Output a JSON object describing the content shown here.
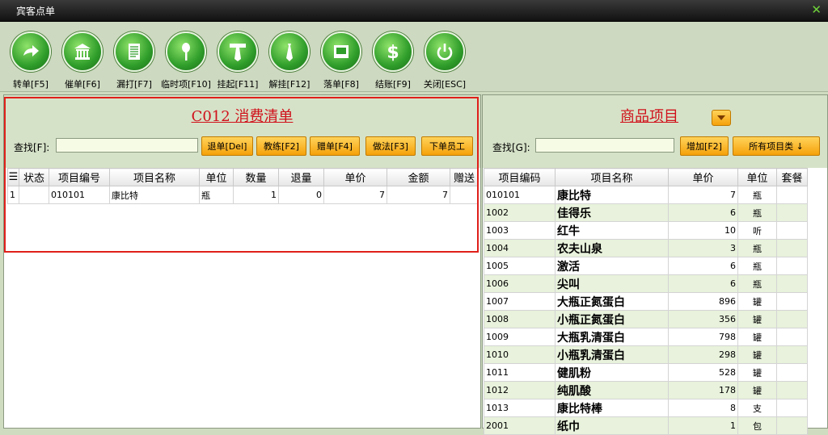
{
  "window": {
    "title": "宾客点单"
  },
  "toolbar": {
    "buttons": [
      {
        "label": "转单[F5]",
        "icon": "arrow-forward-icon"
      },
      {
        "label": "催单[F6]",
        "icon": "bank-icon"
      },
      {
        "label": "漏打[F7]",
        "icon": "document-icon"
      },
      {
        "label": "临时项[F10]",
        "icon": "utensils-icon"
      },
      {
        "label": "挂起[F11]",
        "icon": "tie-icon"
      },
      {
        "label": "解挂[F12]",
        "icon": "necktie-icon"
      },
      {
        "label": "落单[F8]",
        "icon": "receipt-icon"
      },
      {
        "label": "结账[F9]",
        "icon": "dollar-icon"
      },
      {
        "label": "关闭[ESC]",
        "icon": "power-icon"
      }
    ]
  },
  "left": {
    "title": "C012 消费清单",
    "search_label": "查找[F]:",
    "search_value": "",
    "buttons": [
      "退单[Del]",
      "教练[F2]",
      "赠单[F4]",
      "做法[F3]",
      "下单员工"
    ],
    "columns": [
      "状态",
      "项目编号",
      "项目名称",
      "单位",
      "数量",
      "退量",
      "单价",
      "金额",
      "赠送"
    ],
    "rows": [
      {
        "idx": "1",
        "status": "",
        "code": "010101",
        "name": "康比特",
        "unit": "瓶",
        "qty": "1",
        "ret": "0",
        "price": "7",
        "amount": "7",
        "gift": ""
      }
    ]
  },
  "right": {
    "title": "商品项目",
    "search_label": "查找[G]:",
    "search_value": "",
    "add_button": "增加[F2]",
    "category_button": "所有项目类 ↓",
    "columns": [
      "项目编码",
      "项目名称",
      "单价",
      "单位",
      "套餐"
    ],
    "rows": [
      {
        "code": "010101",
        "name": "康比特",
        "price": "7",
        "unit": "瓶",
        "set": ""
      },
      {
        "code": "1002",
        "name": "佳得乐",
        "price": "6",
        "unit": "瓶",
        "set": ""
      },
      {
        "code": "1003",
        "name": "红牛",
        "price": "10",
        "unit": "听",
        "set": ""
      },
      {
        "code": "1004",
        "name": "农夫山泉",
        "price": "3",
        "unit": "瓶",
        "set": ""
      },
      {
        "code": "1005",
        "name": "激活",
        "price": "6",
        "unit": "瓶",
        "set": ""
      },
      {
        "code": "1006",
        "name": "尖叫",
        "price": "6",
        "unit": "瓶",
        "set": ""
      },
      {
        "code": "1007",
        "name": "大瓶正氮蛋白",
        "price": "896",
        "unit": "罐",
        "set": ""
      },
      {
        "code": "1008",
        "name": "小瓶正氮蛋白",
        "price": "356",
        "unit": "罐",
        "set": ""
      },
      {
        "code": "1009",
        "name": "大瓶乳清蛋白",
        "price": "798",
        "unit": "罐",
        "set": ""
      },
      {
        "code": "1010",
        "name": "小瓶乳清蛋白",
        "price": "298",
        "unit": "罐",
        "set": ""
      },
      {
        "code": "1011",
        "name": "健肌粉",
        "price": "528",
        "unit": "罐",
        "set": ""
      },
      {
        "code": "1012",
        "name": "纯肌酸",
        "price": "178",
        "unit": "罐",
        "set": ""
      },
      {
        "code": "1013",
        "name": "康比特棒",
        "price": "8",
        "unit": "支",
        "set": ""
      },
      {
        "code": "2001",
        "name": "纸巾",
        "price": "1",
        "unit": "包",
        "set": ""
      }
    ]
  }
}
